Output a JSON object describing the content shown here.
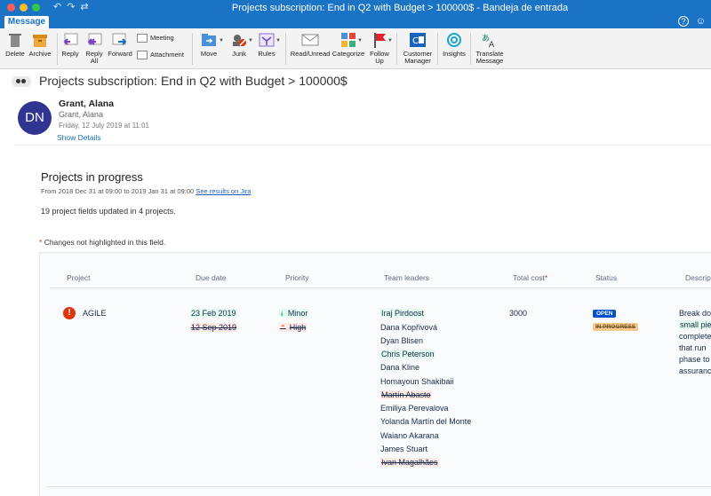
{
  "window": {
    "title": "Projects subscription: End in Q2 with Budget > 100000$ - Bandeja de entrada"
  },
  "tabs": {
    "active": "Message"
  },
  "ribbon": {
    "delete": "Delete",
    "archive": "Archive",
    "reply": "Reply",
    "reply_all_1": "Reply",
    "reply_all_2": "All",
    "forward": "Forward",
    "meeting": "Meeting",
    "attachment": "Attachment",
    "move": "Move",
    "junk": "Junk",
    "rules": "Rules",
    "read_unread": "Read/Unread",
    "categorize": "Categorize",
    "follow_up_1": "Follow",
    "follow_up_2": "Up",
    "customer_manager_1": "Customer",
    "customer_manager_2": "Manager",
    "insights": "Insights",
    "translate_1": "Translate",
    "translate_2": "Message"
  },
  "email": {
    "subject": "Projects subscription: End in Q2 with Budget > 100000$",
    "avatar_initials": "DN",
    "sender_name": "Grant, Alana",
    "sender_sub": "Grant, Alana",
    "date": "Friday, 12 July 2019 at 11:01",
    "show_details": "Show Details"
  },
  "body": {
    "heading": "Projects in progress",
    "range_text": "From 2018 Dec 31 at 09:00 to 2019 Jan 31 at 09:00",
    "range_link": "See results on Jira",
    "updated": "19 project fields updated in 4 projects.",
    "changes_star": "*",
    "changes_note": "Changes not highlighted in this field."
  },
  "table": {
    "headers": {
      "project": "Project",
      "due_date": "Due date",
      "priority": "Priority",
      "team_leaders": "Team leaders",
      "total_cost": "Total cost",
      "total_cost_star": "*",
      "status": "Status",
      "description": "Descript"
    },
    "row": {
      "project": "AGILE",
      "due_new": "23 Feb 2019",
      "due_old": "12 Sep 2019",
      "priority_new": "Minor",
      "priority_old": "High",
      "total_cost": "3000",
      "status_new": "OPEN",
      "status_old": "IN PROGRESS",
      "leaders": [
        "Iraj Pirdoost",
        "Dana Kopřivová",
        "Dyan Blisen",
        "Chris Peterson",
        "Dana Kline",
        "Homayoun Shakibaii",
        "Martín Abasto",
        "Emiliya Perevalova",
        "Yolanda Martín del Monte",
        "Waiano Akarana",
        "James Stuart",
        "Ivan Magalhães"
      ],
      "description_lines": [
        "Break do",
        "small pie",
        "complete",
        "that run",
        "phase to",
        "assuranc"
      ]
    }
  }
}
